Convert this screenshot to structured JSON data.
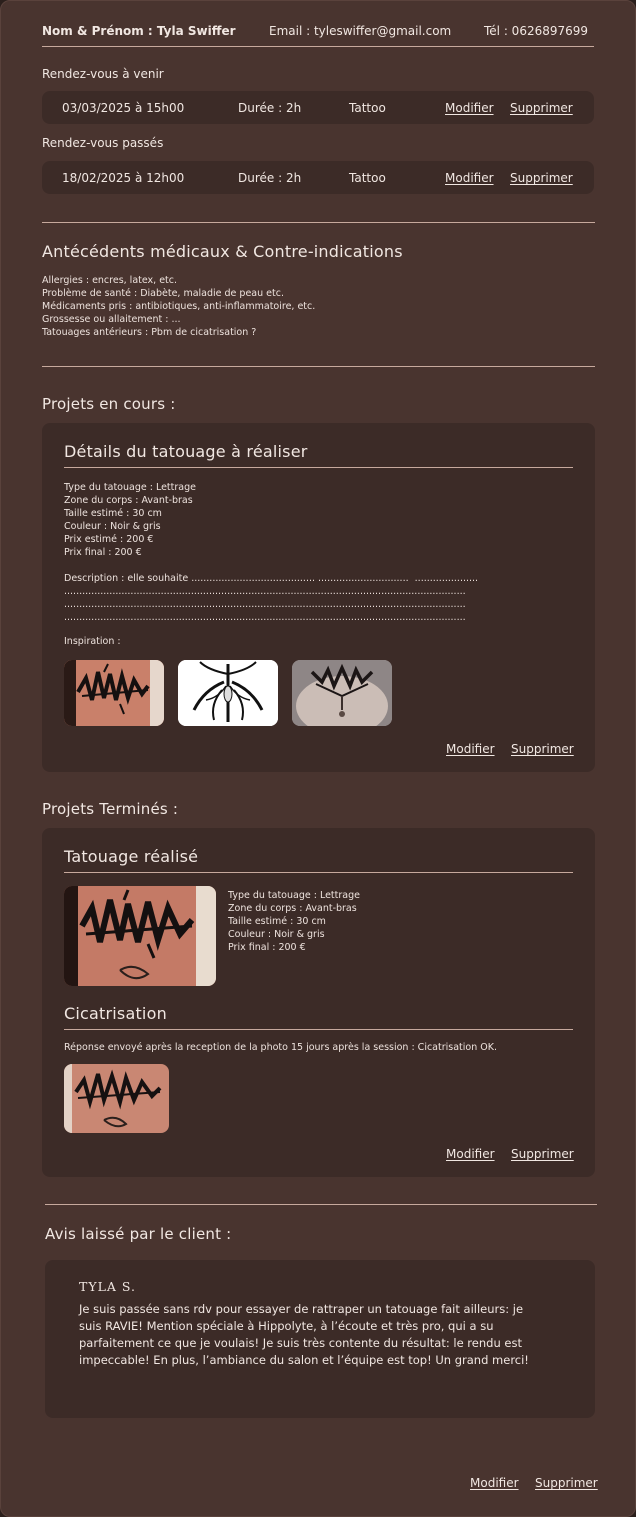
{
  "header": {
    "name": "Nom & Prénom : Tyla Swiffer",
    "email": "Email : tyleswiffer@gmail.com",
    "phone": "Tél : 0626897699"
  },
  "upcoming": {
    "title": "Rendez-vous à venir",
    "date": "03/03/2025 à 15h00",
    "duration": "Durée : 2h",
    "type": "Tattoo",
    "edit": "Modifier",
    "delete": "Supprimer"
  },
  "past": {
    "title": "Rendez-vous passés",
    "date": "18/02/2025 à 12h00",
    "duration": "Durée : 2h",
    "type": "Tattoo",
    "edit": "Modifier",
    "delete": "Supprimer"
  },
  "medical": {
    "title": "Antécédents médicaux & Contre-indications",
    "lines": "Allergies : encres, latex, etc.\nProblème de santé : Diabète, maladie de peau etc.\nMédicaments pris : antibiotiques, anti-inflammatoire, etc.\nGrossesse ou allaitement : ...\nTatouages antérieurs : Pbm de cicatrisation ?"
  },
  "current_projects": {
    "section_title": "Projets en cours :",
    "card_title": "Détails du tatouage à réaliser",
    "details": "Type du tatouage : Lettrage\nZone du corps : Avant-bras\nTaille estimé : 30 cm\nCouleur : Noir & gris\nPrix estimé : 200 €\nPrix final : 200 €",
    "description": "Description : elle souhaite ......................................... ..............................  .....................\n.....................................................................................................................................\n.....................................................................................................................................\n.....................................................................................................................................",
    "inspiration_label": "Inspiration :",
    "edit": "Modifier",
    "delete": "Supprimer"
  },
  "finished_projects": {
    "section_title": "Projets Terminés :",
    "card_title": "Tatouage réalisé",
    "details": "Type du tatouage : Lettrage\nZone du corps : Avant-bras\nTaille estimé : 30 cm\nCouleur : Noir & gris\nPrix final : 200 €",
    "healing_title": "Cicatrisation",
    "healing_text": "Réponse envoyé après la reception de la photo 15 jours après la session : Cicatrisation OK.",
    "edit": "Modifier",
    "delete": "Supprimer"
  },
  "review": {
    "section_title": "Avis laissé par le client :",
    "author": "TYLA S.",
    "text": "Je suis passée sans rdv pour essayer de rattraper un tatouage fait ailleurs: je suis RAVIE! Mention spéciale à Hippolyte, à l’écoute et très pro, qui a su parfaitement ce que je voulais! Je suis très contente du résultat: le rendu est impeccable! En plus, l’ambiance du salon et l’équipe est top! Un grand merci!"
  },
  "footer": {
    "edit": "Modifier",
    "delete": "Supprimer"
  },
  "colors": {
    "page_bg": "#49342f",
    "card_bg": "#3c2b27",
    "divider": "#c7a99d",
    "text": "#f1e7e2"
  },
  "images": {
    "inspiration": [
      "lettering-tattoo-photo",
      "symmetrical-ornament-drawing",
      "neck-tattoo-photo"
    ],
    "finished": "lettering-tattoo-healed-photo",
    "healing": "lettering-tattoo-healing-photo"
  }
}
